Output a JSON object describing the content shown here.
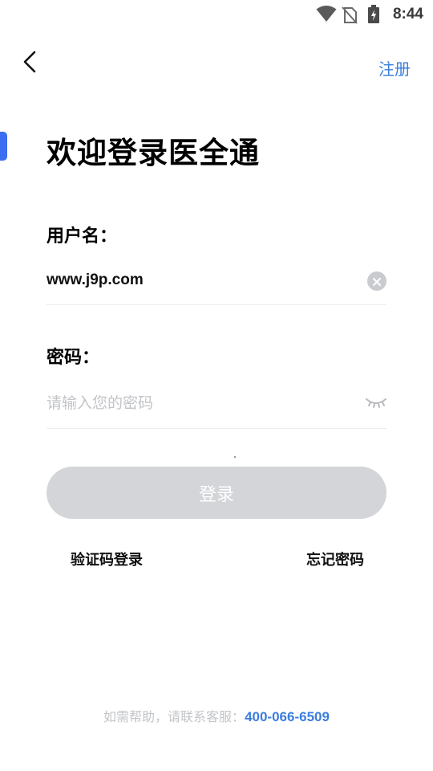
{
  "status_bar": {
    "time": "8:44",
    "icons": [
      "wifi-icon",
      "no-sim-icon",
      "battery-charging-icon"
    ]
  },
  "header": {
    "back_icon": "chevron-left-icon",
    "register_label": "注册"
  },
  "title": "欢迎登录医全通",
  "form": {
    "username_label": "用户名：",
    "username_value": "www.j9p.com",
    "clear_icon": "clear-icon",
    "password_label": "密码：",
    "password_placeholder": "请输入您的密码",
    "eye_icon": "eye-closed-icon",
    "login_label": "登录"
  },
  "links": {
    "sms_login": "验证码登录",
    "forgot_password": "忘记密码"
  },
  "help": {
    "text": "如需帮助，请联系客服：",
    "phone": "400-066-6509"
  },
  "colors": {
    "accent": "#3b7ddd",
    "button_disabled": "#d3d5d9",
    "placeholder": "#c2c4c8"
  }
}
